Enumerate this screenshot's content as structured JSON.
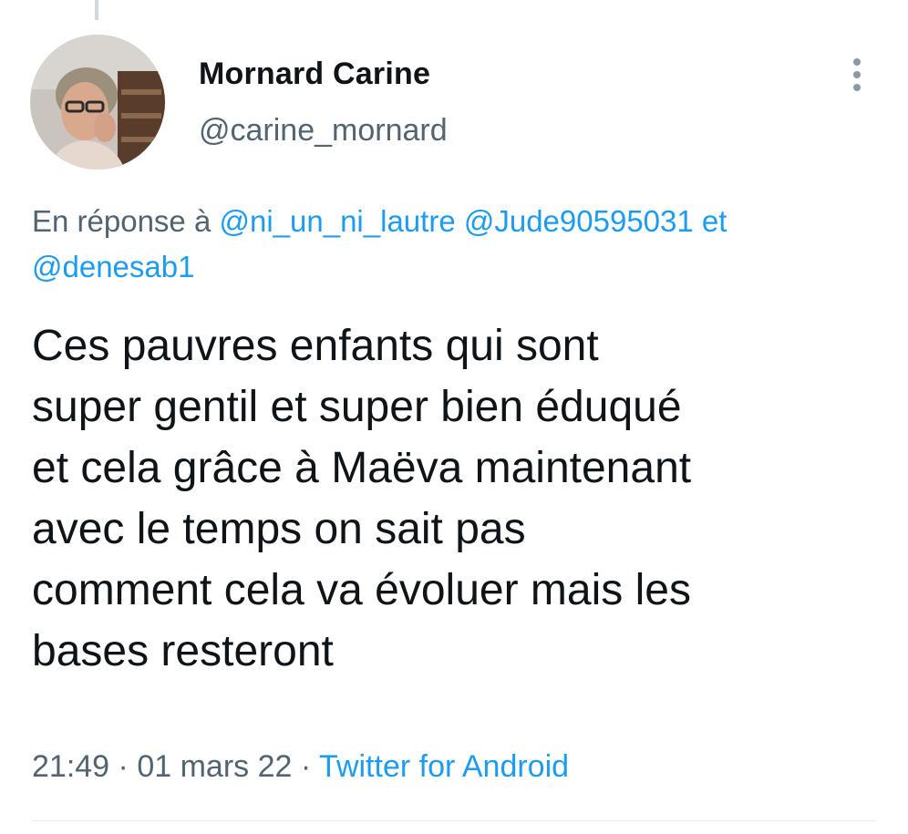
{
  "tweet": {
    "author": {
      "display_name": "Mornard Carine",
      "handle": "@carine_mornard"
    },
    "reply_prefix": "En réponse à",
    "reply_mentions": [
      "@ni_un_ni_lautre",
      "@Jude90595031",
      "@denesab1"
    ],
    "reply_conjunction": "et",
    "text": "Ces pauvres enfants qui sont\nsuper gentil et super bien éduqué\net cela grâce à Maëva maintenant\navec le temps on sait pas\ncomment cela va évoluer mais les\nbases resteront",
    "time": "21:49",
    "date": "01 mars 22",
    "separator": "·",
    "source": "Twitter for Android"
  },
  "colors": {
    "link": "#1d9bf0",
    "secondary_text": "#536471",
    "primary_text": "#0f1419"
  },
  "icons": {
    "more": "more-vertical-icon"
  }
}
